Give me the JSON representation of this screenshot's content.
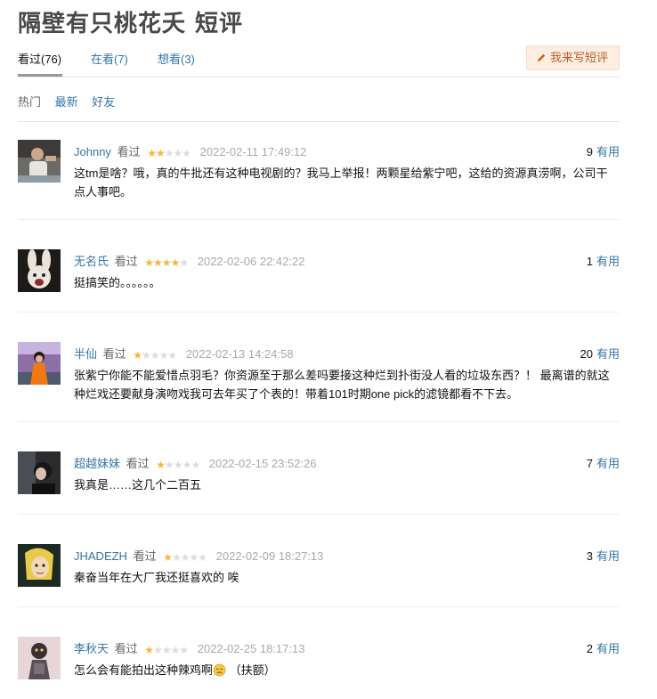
{
  "page": {
    "title": "隔壁有只桃花夭 短评",
    "write_button": "我来写短评",
    "pencil_color": "#d45d22"
  },
  "tabs": [
    {
      "label": "看过(76)",
      "active": true
    },
    {
      "label": "在看(7)",
      "active": false
    },
    {
      "label": "想看(3)",
      "active": false
    }
  ],
  "sorts": [
    {
      "label": "热门",
      "active": true
    },
    {
      "label": "最新",
      "active": false
    },
    {
      "label": "好友",
      "active": false
    }
  ],
  "colors": {
    "link": "#3377aa",
    "star": "#f6b732",
    "button_bg": "#fdeee2"
  },
  "reviews": [
    {
      "author": "Johnny",
      "status": "看过",
      "rating": 2,
      "time": "2022-02-11 17:49:12",
      "votes": "9",
      "useful_label": "有用",
      "content": "这tm是啥？哦，真的牛批还有这种电视剧的？我马上举报！两颗星给紫宁吧，这给的资源真涝啊，公司干点人事吧。",
      "avatar": "man-photo"
    },
    {
      "author": "无名氏",
      "status": "看过",
      "rating": 4,
      "time": "2022-02-06 22:42:22",
      "votes": "1",
      "useful_label": "有用",
      "content": "挺搞笑的。。。。。。",
      "avatar": "rabbit-ears-photo"
    },
    {
      "author": "半仙",
      "status": "看过",
      "rating": 1,
      "time": "2022-02-13 14:24:58",
      "votes": "20",
      "useful_label": "有用",
      "content": "张紫宁你能不能爱惜点羽毛？你资源至于那么差吗要接这种烂到扑街没人看的垃圾东西？！ 最离谱的就这种烂戏还要献身演吻戏我可去年买了个表的！带着101时期one pick的滤镜都看不下去。",
      "avatar": "orange-figure-photo"
    },
    {
      "author": "超越妹妹",
      "status": "看过",
      "rating": 1,
      "time": "2022-02-15 23:52:26",
      "votes": "7",
      "useful_label": "有用",
      "content": "我真是……这几个二百五",
      "avatar": "dark-portrait-photo"
    },
    {
      "author": "JHADEZH",
      "status": "看过",
      "rating": 1,
      "time": "2022-02-09 18:27:13",
      "votes": "3",
      "useful_label": "有用",
      "content": "秦奋当年在大厂我还挺喜欢的 唉",
      "avatar": "cartoon-girl-image"
    },
    {
      "author": "李秋天",
      "status": "看过",
      "rating": 1,
      "time": "2022-02-25 18:17:13",
      "votes": "2",
      "useful_label": "有用",
      "content": "怎么会有能拍出这种辣鸡啊",
      "content_tail": "（扶额）",
      "avatar": "pumpkin-figure-image"
    }
  ]
}
